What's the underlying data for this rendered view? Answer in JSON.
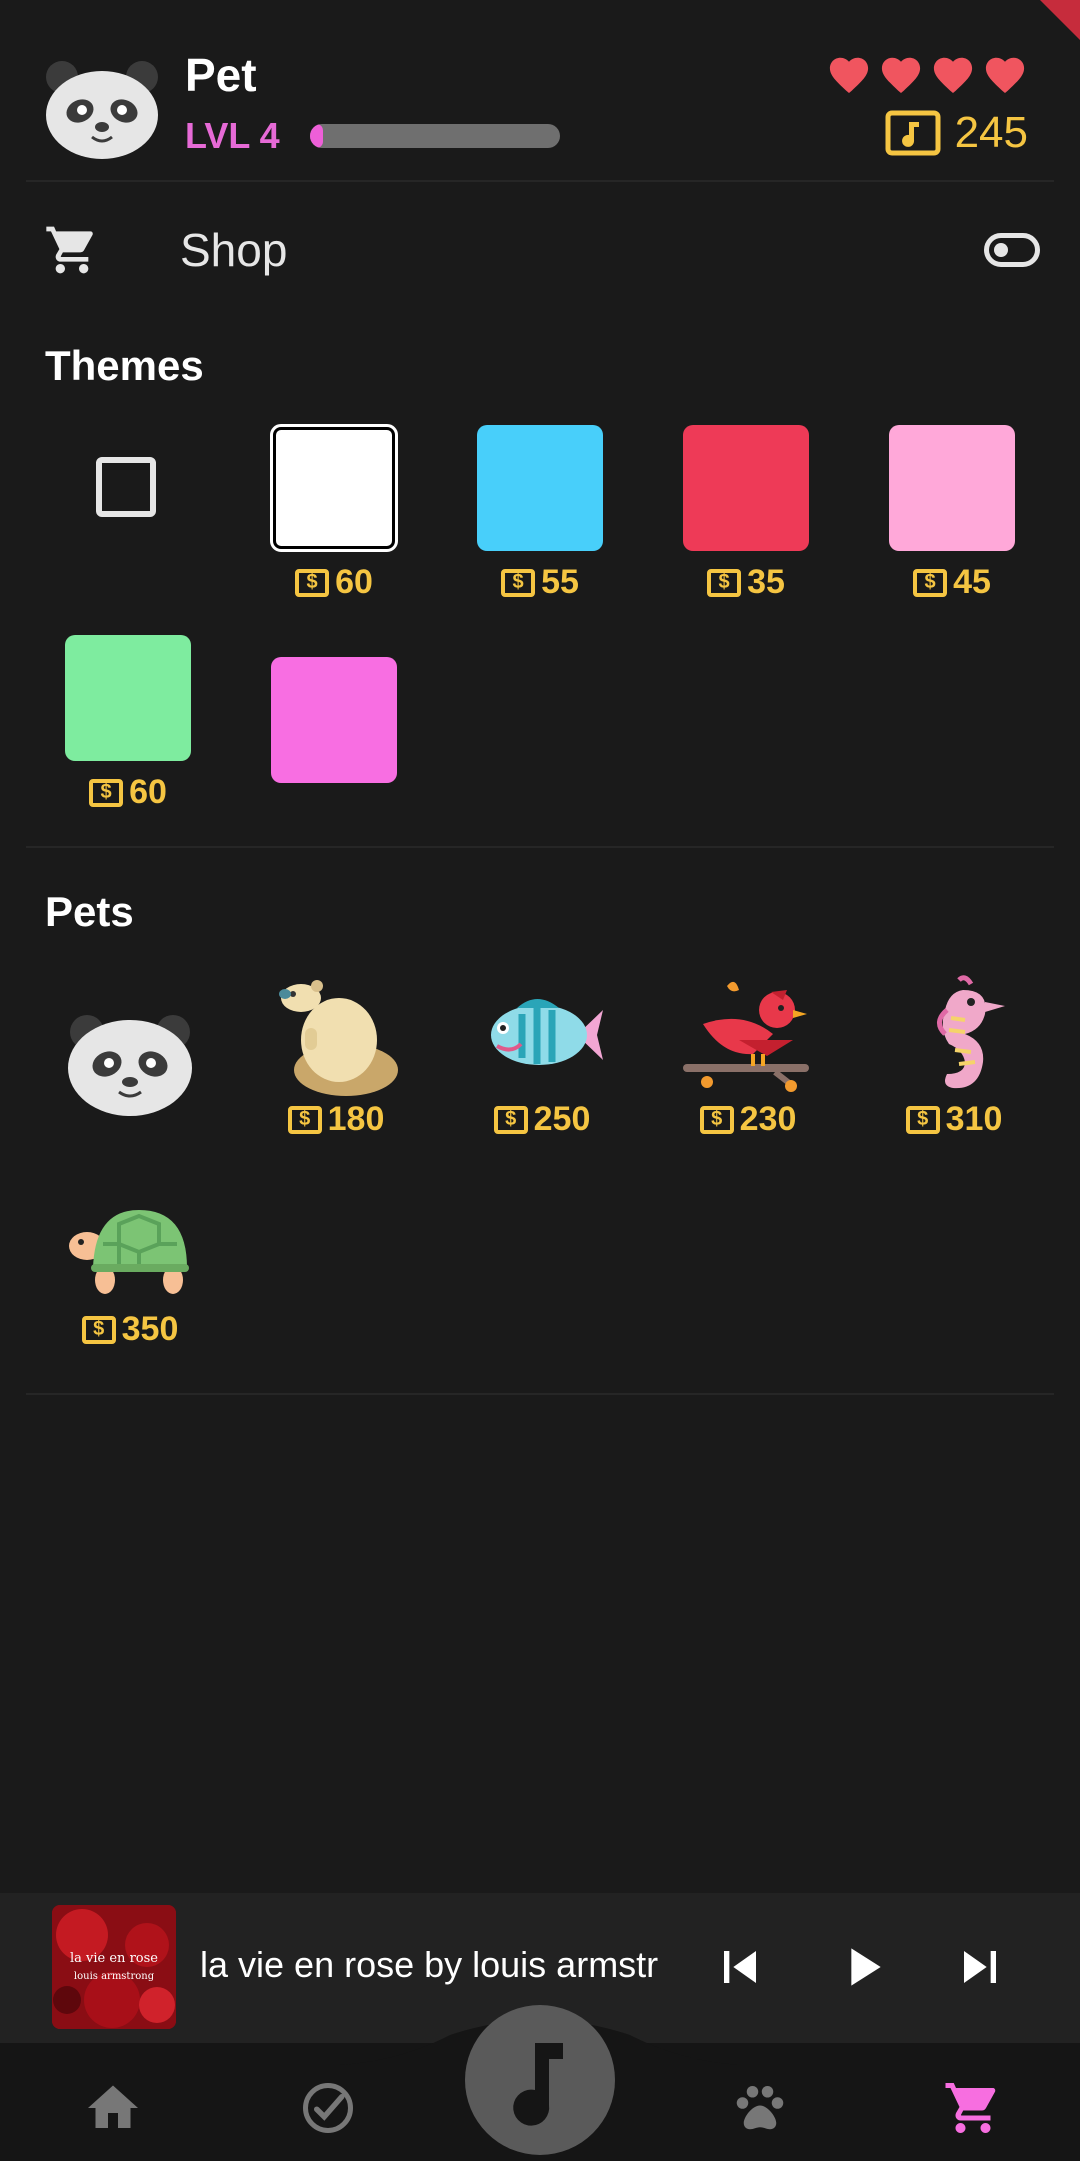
{
  "header": {
    "pet_name": "Pet",
    "level_label": "LVL 4",
    "xp_progress": 0.05,
    "hearts": 4,
    "coins": "245"
  },
  "shop_bar": {
    "title": "Shop"
  },
  "themes": {
    "title": "Themes",
    "items": [
      {
        "color": "none",
        "price": ""
      },
      {
        "color": "#ffffff",
        "price": "60",
        "selected": true
      },
      {
        "color": "#48cffa",
        "price": "55"
      },
      {
        "color": "#ee3a57",
        "price": "35"
      },
      {
        "color": "#ffa8d9",
        "price": "45"
      },
      {
        "color": "#7eec9f",
        "price": "60"
      },
      {
        "color": "#f86ee2",
        "price": ""
      }
    ]
  },
  "pets": {
    "title": "Pets",
    "items": [
      {
        "icon": "panda-icon",
        "price": ""
      },
      {
        "icon": "capybara-icon",
        "price": "180"
      },
      {
        "icon": "fish-icon",
        "price": "250"
      },
      {
        "icon": "bird-icon",
        "price": "230"
      },
      {
        "icon": "seahorse-icon",
        "price": "310"
      },
      {
        "icon": "turtle-icon",
        "price": "350"
      }
    ]
  },
  "player": {
    "now_playing": "la vie en rose by louis armstr",
    "album_title": "la vie en rose",
    "album_artist": "louis armstrong"
  },
  "nav": {
    "items": [
      "home-icon",
      "check-circle-icon",
      "music-note-icon",
      "paw-icon",
      "cart-icon"
    ],
    "active": "cart-icon",
    "active_color": "#f76ee0"
  },
  "colors": {
    "accent": "#e66ad6",
    "gold": "#f5c542",
    "heart": "#f0555f"
  }
}
